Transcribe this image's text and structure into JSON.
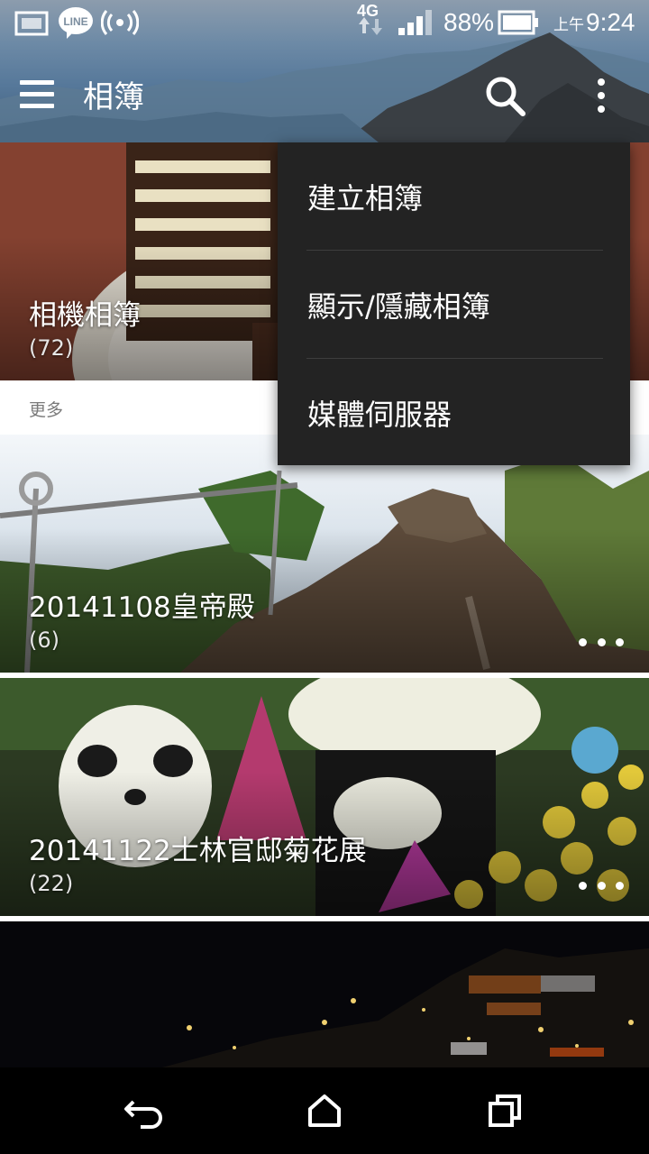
{
  "status_bar": {
    "network_type": "4G",
    "battery_percent": "88%",
    "time_period": "上午",
    "time": "9:24",
    "line_badge": "LINE",
    "icons": [
      "screenshot-icon",
      "line-icon",
      "hotspot-icon",
      "signal-icon",
      "battery-icon"
    ]
  },
  "action_bar": {
    "title": "相簿",
    "icons": [
      "hamburger-menu-icon",
      "search-icon",
      "more-vert-icon"
    ]
  },
  "albums": [
    {
      "name": "相機相簿",
      "count": "(72)"
    },
    {
      "name": "20141108皇帝殿",
      "count": "(6)"
    },
    {
      "name": "20141122士林官邸菊花展",
      "count": "(22)"
    }
  ],
  "section": {
    "more_label": "更多"
  },
  "popup_menu": {
    "items": [
      "建立相簿",
      "顯示/隱藏相簿",
      "媒體伺服器"
    ]
  },
  "nav_bar": {
    "icons": [
      "back-icon",
      "home-icon",
      "recents-icon"
    ]
  },
  "colors": {
    "popup_bg": "#232323",
    "nav_bg": "#000000",
    "section_label": "#7a7a7a"
  }
}
